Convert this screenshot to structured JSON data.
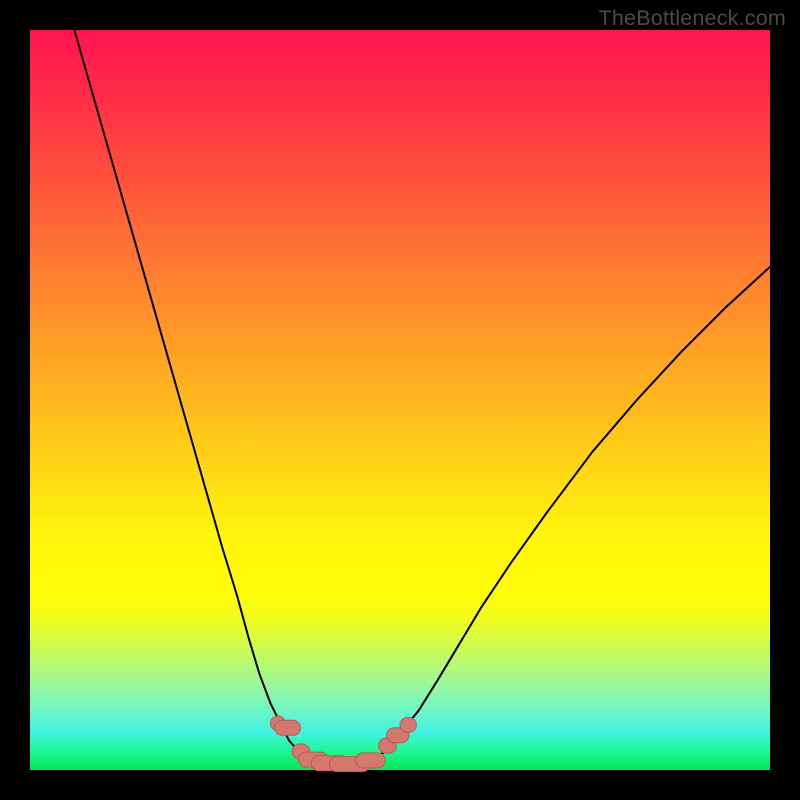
{
  "watermark": {
    "text": "TheBottleneck.com"
  },
  "colors": {
    "curve": "#000000",
    "marker_fill": "#d6776f",
    "marker_stroke": "#b85c54",
    "background_frame": "#000000"
  },
  "chart_data": {
    "type": "line",
    "title": "",
    "xlabel": "",
    "ylabel": "",
    "xlim": [
      0,
      100
    ],
    "ylim": [
      0,
      100
    ],
    "grid": false,
    "axes_visible": false,
    "note": "Values are estimated from pixel positions on an unlabelled axis; y is bottleneck % (0 at bottom, 100 at top).",
    "series": [
      {
        "name": "left-branch",
        "x": [
          6.0,
          8.0,
          10.0,
          12.0,
          14.0,
          16.0,
          18.0,
          20.0,
          22.0,
          24.0,
          26.0,
          28.0,
          29.5,
          31.0,
          32.5,
          34.0,
          35.0,
          36.5,
          38.0
        ],
        "y": [
          100.0,
          93.0,
          86.0,
          79.0,
          72.0,
          65.0,
          58.0,
          51.0,
          44.0,
          37.0,
          30.0,
          23.5,
          18.0,
          13.0,
          9.0,
          6.0,
          4.0,
          2.3,
          1.3
        ]
      },
      {
        "name": "valley-floor",
        "x": [
          38.0,
          40.0,
          42.0,
          44.0,
          46.0
        ],
        "y": [
          1.3,
          0.9,
          0.8,
          0.9,
          1.3
        ]
      },
      {
        "name": "right-branch",
        "x": [
          46.0,
          48.0,
          50.0,
          52.5,
          55.0,
          58.0,
          61.0,
          65.0,
          70.0,
          76.0,
          82.0,
          88.0,
          94.0,
          100.0
        ],
        "y": [
          1.3,
          2.5,
          5.0,
          8.0,
          12.0,
          17.0,
          22.0,
          28.0,
          35.0,
          43.0,
          50.0,
          56.5,
          62.5,
          68.0
        ]
      }
    ],
    "markers": {
      "name": "highlight-points",
      "shape": "capsule",
      "points": [
        {
          "x": 33.5,
          "y": 6.3,
          "len": 2.0
        },
        {
          "x": 34.8,
          "y": 5.7,
          "len": 3.5
        },
        {
          "x": 36.6,
          "y": 2.5,
          "len": 2.4
        },
        {
          "x": 38.3,
          "y": 1.4,
          "len": 4.0
        },
        {
          "x": 40.5,
          "y": 0.9,
          "len": 5.0
        },
        {
          "x": 43.2,
          "y": 0.8,
          "len": 5.5
        },
        {
          "x": 46.0,
          "y": 1.3,
          "len": 4.0
        },
        {
          "x": 48.3,
          "y": 3.3,
          "len": 2.4
        },
        {
          "x": 49.7,
          "y": 4.7,
          "len": 3.0
        },
        {
          "x": 51.1,
          "y": 6.1,
          "len": 2.2
        }
      ]
    }
  }
}
